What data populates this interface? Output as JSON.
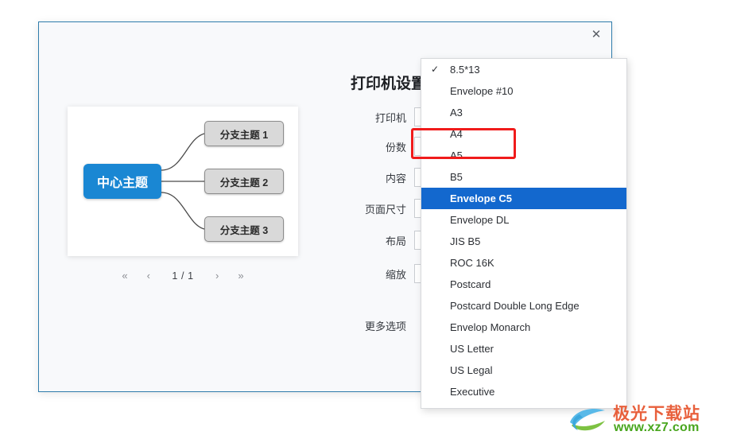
{
  "dialog": {
    "title": "打印机设置",
    "close_label": "✕"
  },
  "preview": {
    "mindmap": {
      "central_topic": "中心主题",
      "branches": [
        {
          "label": "分支主题 1"
        },
        {
          "label": "分支主题 2"
        },
        {
          "label": "分支主题 3"
        }
      ]
    },
    "pagination": {
      "first": "«",
      "prev": "‹",
      "indicator": "1 / 1",
      "next": "›",
      "last": "»"
    }
  },
  "settings": {
    "rows": [
      {
        "label": "打印机"
      },
      {
        "label": "份数"
      },
      {
        "label": "内容"
      },
      {
        "label": "页面尺寸"
      },
      {
        "label": "布局"
      },
      {
        "label": "缩放"
      },
      {
        "label": "更多选项"
      }
    ]
  },
  "pagesize_dropdown": {
    "checked_value": "8.5*13",
    "highlighted_value": "Envelope C5",
    "check_glyph": "✓",
    "items": [
      {
        "label": "8.5*13",
        "checked": true,
        "selected": false
      },
      {
        "label": "Envelope #10",
        "checked": false,
        "selected": false
      },
      {
        "label": "A3",
        "checked": false,
        "selected": false
      },
      {
        "label": "A4",
        "checked": false,
        "selected": false
      },
      {
        "label": "A5",
        "checked": false,
        "selected": false
      },
      {
        "label": "B5",
        "checked": false,
        "selected": false
      },
      {
        "label": "Envelope C5",
        "checked": false,
        "selected": true
      },
      {
        "label": "Envelope DL",
        "checked": false,
        "selected": false
      },
      {
        "label": "JIS B5",
        "checked": false,
        "selected": false
      },
      {
        "label": "ROC 16K",
        "checked": false,
        "selected": false
      },
      {
        "label": "Postcard",
        "checked": false,
        "selected": false
      },
      {
        "label": "Postcard Double Long Edge",
        "checked": false,
        "selected": false
      },
      {
        "label": "Envelop Monarch",
        "checked": false,
        "selected": false
      },
      {
        "label": "US Letter",
        "checked": false,
        "selected": false
      },
      {
        "label": "US Legal",
        "checked": false,
        "selected": false
      },
      {
        "label": "Executive",
        "checked": false,
        "selected": false
      }
    ]
  },
  "watermark": {
    "site_name": "极光下载站",
    "url": "www.xz7.com"
  },
  "colors": {
    "dialog_border": "#2f7cab",
    "central_topic": "#1a87d3",
    "dropdown_highlight": "#1368ce",
    "annotation_red": "#f01b1b",
    "watermark_orange": "#e8603c",
    "watermark_green": "#49a61e"
  }
}
